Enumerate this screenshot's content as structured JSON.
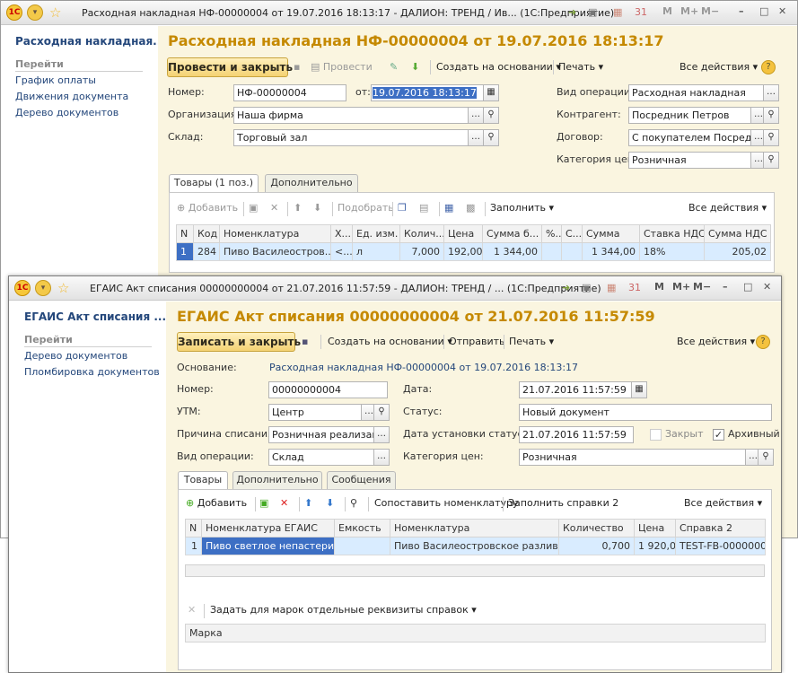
{
  "w1": {
    "title": "Расходная накладная НФ-00000004 от 19.07.2016 18:13:17 - ДАЛИОН: ТРЕНД / Ив... (1С:Предприятие)",
    "side": {
      "doc": "Расходная накладная...",
      "go": "Перейти",
      "links": [
        "График оплаты",
        "Движения документа",
        "Дерево документов"
      ]
    },
    "heading": "Расходная накладная НФ-00000004 от 19.07.2016 18:13:17",
    "toolbar": {
      "post_close": "Провести и закрыть",
      "post": "Провести",
      "create_based": "Создать на основании",
      "print": "Печать",
      "all_actions": "Все действия"
    },
    "form": {
      "number_label": "Номер:",
      "number": "НФ-00000004",
      "date_label": "от:",
      "date": "19.07.2016 18:13:17",
      "org_label": "Организация:",
      "org": "Наша фирма",
      "wh_label": "Склад:",
      "wh": "Торговый зал",
      "op_label": "Вид операции:",
      "op": "Расходная накладная",
      "ctr_label": "Контрагент:",
      "ctr": "Посредник Петров",
      "contract_label": "Договор:",
      "contract": "С покупателем Посредни",
      "price_label": "Категория цен:",
      "price": "Розничная"
    },
    "tabs": [
      "Товары (1 поз.)",
      "Дополнительно"
    ],
    "table_tb": {
      "add": "Добавить",
      "pick": "Подобрать",
      "fill": "Заполнить",
      "all": "Все действия"
    },
    "cols": [
      "N",
      "Код",
      "Номенклатура",
      "Х...",
      "Ед. изм.",
      "Колич...",
      "Цена",
      "Сумма б...",
      "%...",
      "С...",
      "Сумма",
      "Ставка НДС",
      "Сумма НДС"
    ],
    "row": [
      "1",
      "284",
      "Пиво Василеостров...",
      "<...",
      "л",
      "7,000",
      "192,00",
      "1 344,00",
      "",
      "",
      "1 344,00",
      "18%",
      "205,02"
    ]
  },
  "w2": {
    "title": "ЕГАИС Акт списания 00000000004 от 21.07.2016 11:57:59 - ДАЛИОН: ТРЕНД / ... (1С:Предприятие)",
    "side": {
      "doc": "ЕГАИС Акт списания ...",
      "go": "Перейти",
      "links": [
        "Дерево документов",
        "Пломбировка документов"
      ]
    },
    "heading": "ЕГАИС Акт списания 00000000004 от 21.07.2016 11:57:59",
    "toolbar": {
      "save_close": "Записать и закрыть",
      "create_based": "Создать на основании",
      "send": "Отправить",
      "print": "Печать",
      "all_actions": "Все действия"
    },
    "form": {
      "basis_label": "Основание:",
      "basis": "Расходная накладная НФ-00000004 от 19.07.2016 18:13:17",
      "number_label": "Номер:",
      "number": "00000000004",
      "utm_label": "УТМ:",
      "utm": "Центр",
      "reason_label": "Причина списания:",
      "reason": "Розничная реализация",
      "op_label": "Вид операции:",
      "op": "Склад",
      "date_label": "Дата:",
      "date": "21.07.2016 11:57:59",
      "status_label": "Статус:",
      "status": "Новый документ",
      "status_date_label": "Дата установки статуса:",
      "status_date": "21.07.2016 11:57:59",
      "closed_label": "Закрыт",
      "archive_label": "Архивный",
      "price_label": "Категория цен:",
      "price": "Розничная"
    },
    "tabs": [
      "Товары",
      "Дополнительно",
      "Сообщения"
    ],
    "table_tb": {
      "add": "Добавить",
      "match": "Сопоставить номенклатуру",
      "fill": "Заполнить справки 2",
      "all": "Все действия"
    },
    "cols": [
      "N",
      "Номенклатура ЕГАИС",
      "Емкость",
      "Номенклатура",
      "Количество",
      "Цена",
      "Справка 2"
    ],
    "row": [
      "1",
      "Пиво светлое непастери...",
      "",
      "Пиво Василеостровское разливн...",
      "0,700",
      "1 920,00",
      "TEST-FB-00000002"
    ],
    "marks_tb": "Задать для марок отдельные реквизиты справок",
    "marks_col": "Марка"
  }
}
